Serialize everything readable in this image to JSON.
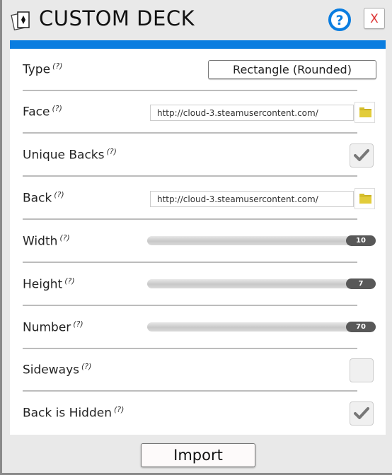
{
  "window": {
    "title": "CUSTOM DECK",
    "help_icon": "question-circle-icon",
    "close_label": "X",
    "accent_color": "#0a7de0"
  },
  "fields": {
    "type": {
      "label": "Type",
      "help": "(?)",
      "value": "Rectangle (Rounded)"
    },
    "face": {
      "label": "Face",
      "help": "(?)",
      "value": "http://cloud-3.steamusercontent.com/",
      "browse_icon": "folder-icon"
    },
    "unique_backs": {
      "label": "Unique Backs",
      "help": "(?)",
      "checked": true
    },
    "back": {
      "label": "Back",
      "help": "(?)",
      "value": "http://cloud-3.steamusercontent.com/",
      "browse_icon": "folder-icon"
    },
    "width": {
      "label": "Width",
      "help": "(?)",
      "value": "10"
    },
    "height": {
      "label": "Height",
      "help": "(?)",
      "value": "7"
    },
    "number": {
      "label": "Number",
      "help": "(?)",
      "value": "70"
    },
    "sideways": {
      "label": "Sideways",
      "help": "(?)",
      "checked": false
    },
    "back_is_hidden": {
      "label": "Back is Hidden",
      "help": "(?)",
      "checked": true
    }
  },
  "footer": {
    "import_label": "Import"
  }
}
